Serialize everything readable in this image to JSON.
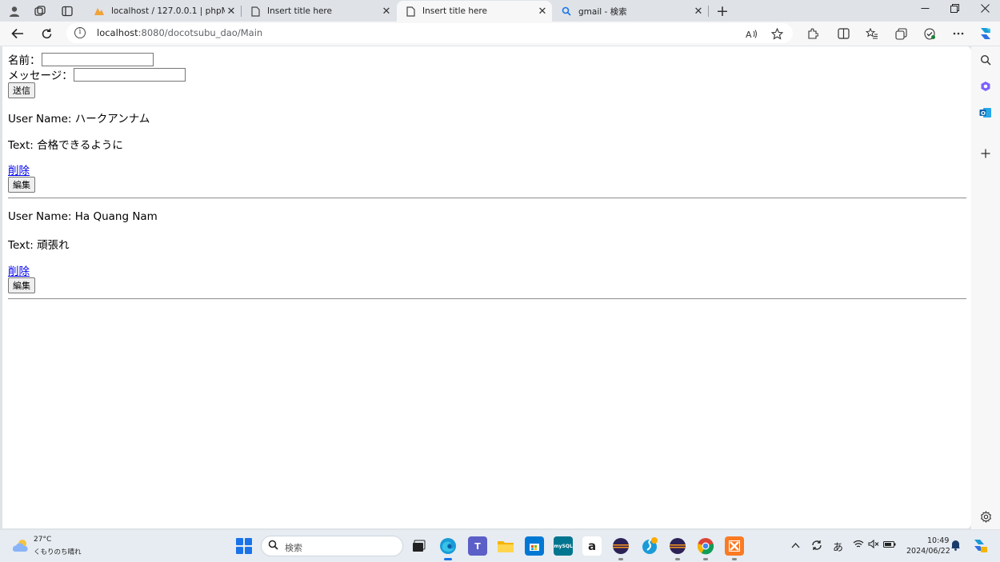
{
  "browser": {
    "tabs": [
      {
        "title": "localhost / 127.0.0.1 | phpMyAdm",
        "icon": "phpmyadmin-icon",
        "active": false
      },
      {
        "title": "Insert title here",
        "icon": "page-icon",
        "active": false
      },
      {
        "title": "Insert title here",
        "icon": "page-icon",
        "active": true
      },
      {
        "title": "gmail - 検索",
        "icon": "search-icon",
        "active": false
      }
    ],
    "close_glyph": "✕",
    "new_tab_glyph": "+",
    "url_host": "localhost",
    "url_path": ":8080/docotsubu_dao/Main",
    "info_glyph": "i"
  },
  "form": {
    "name_label": "名前：",
    "name_value": "",
    "message_label": "メッセージ：",
    "message_value": "",
    "submit_label": "送信"
  },
  "posts": [
    {
      "user_line": "User Name: ハークアンナム",
      "text_line": "Text: 合格できるように",
      "delete_label": "削除",
      "edit_label": "編集"
    },
    {
      "user_line": "User Name: Ha Quang Nam",
      "text_line": "Text: 頑張れ",
      "delete_label": "削除",
      "edit_label": "編集"
    }
  ],
  "taskbar": {
    "weather_temp": "27°C",
    "weather_desc": "くもりのち晴れ",
    "search_placeholder": "検索",
    "ime_label": "あ",
    "clock_time": "10:49",
    "clock_date": "2024/06/22",
    "amazon_label": "a",
    "mysql_label": "mySQL"
  },
  "colors": {
    "link": "#0000ee",
    "accent": "#1a73e8"
  }
}
